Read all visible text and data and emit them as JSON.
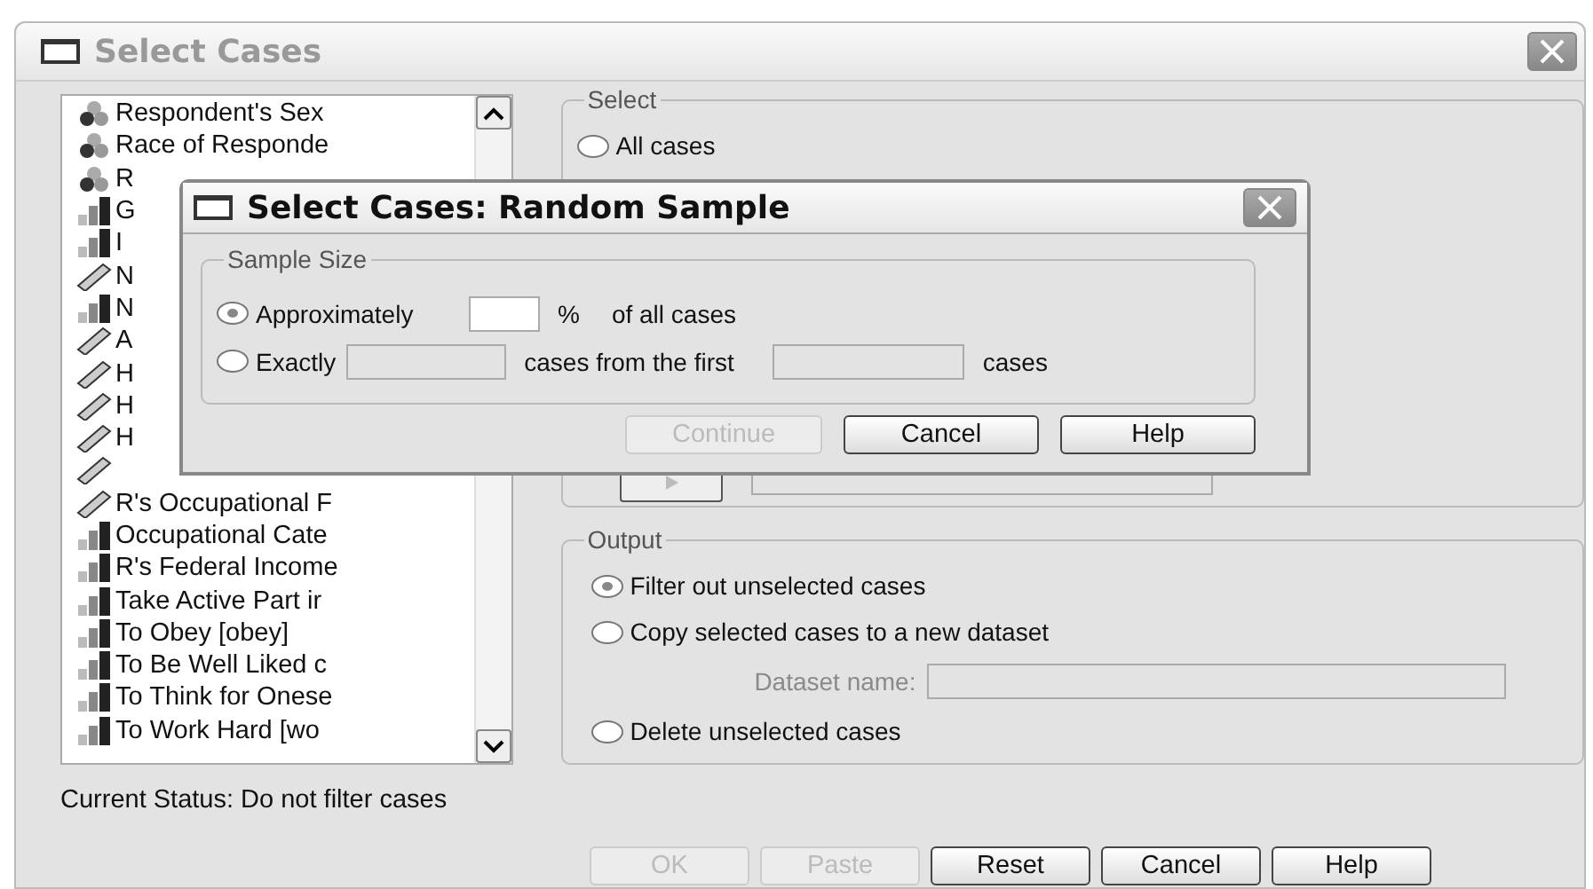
{
  "window": {
    "title": "Select Cases"
  },
  "variables": [
    {
      "label": "Respondent's Sex",
      "kind": "nominal"
    },
    {
      "label": "Race of Responde",
      "kind": "nominal"
    },
    {
      "label": "R",
      "kind": "nominal"
    },
    {
      "label": "G",
      "kind": "ordinal"
    },
    {
      "label": "I",
      "kind": "ordinal"
    },
    {
      "label": "N",
      "kind": "scale"
    },
    {
      "label": "N",
      "kind": "ordinal"
    },
    {
      "label": "A",
      "kind": "scale"
    },
    {
      "label": "H",
      "kind": "scale"
    },
    {
      "label": "H",
      "kind": "scale"
    },
    {
      "label": "H",
      "kind": "scale"
    },
    {
      "kind": "scale"
    },
    {
      "label": "R's Occupational F",
      "kind": "scale"
    },
    {
      "label": "Occupational Cate",
      "kind": "ordinal"
    },
    {
      "label": "R's Federal Income",
      "kind": "ordinal"
    },
    {
      "label": "Take Active Part ir",
      "kind": "ordinal"
    },
    {
      "label": "To Obey [obey]",
      "kind": "ordinal"
    },
    {
      "label": "To Be Well Liked c",
      "kind": "ordinal"
    },
    {
      "label": "To Think for Onese",
      "kind": "ordinal"
    },
    {
      "label": "To Work Hard [wo",
      "kind": "ordinal"
    }
  ],
  "select": {
    "legend": "Select",
    "options": [
      {
        "label": "All cases",
        "selected": false
      }
    ]
  },
  "output": {
    "legend": "Output",
    "options": [
      {
        "label": "Filter out unselected cases",
        "selected": true
      },
      {
        "label": "Copy selected cases to a new dataset",
        "selected": false
      },
      {
        "label": "Delete unselected cases",
        "selected": false
      }
    ],
    "dataset_label": "Dataset name:"
  },
  "status": "Current Status: Do not filter cases",
  "buttons": [
    {
      "label": "OK",
      "disabled": true
    },
    {
      "label": "Paste",
      "disabled": true
    },
    {
      "label": "Reset",
      "disabled": false
    },
    {
      "label": "Cancel",
      "disabled": false
    },
    {
      "label": "Help",
      "disabled": false
    }
  ],
  "dialog": {
    "title": "Select Cases: Random Sample",
    "legend": "Sample Size",
    "approx": {
      "label": "Approximately",
      "selected": true,
      "unit": "%",
      "suffix": "of all cases"
    },
    "exact": {
      "label": "Exactly",
      "selected": false,
      "middle": "cases from the first",
      "suffix": "cases"
    },
    "buttons": [
      {
        "label": "Continue",
        "disabled": true
      },
      {
        "label": "Cancel",
        "disabled": false
      },
      {
        "label": "Help",
        "disabled": false
      }
    ]
  }
}
